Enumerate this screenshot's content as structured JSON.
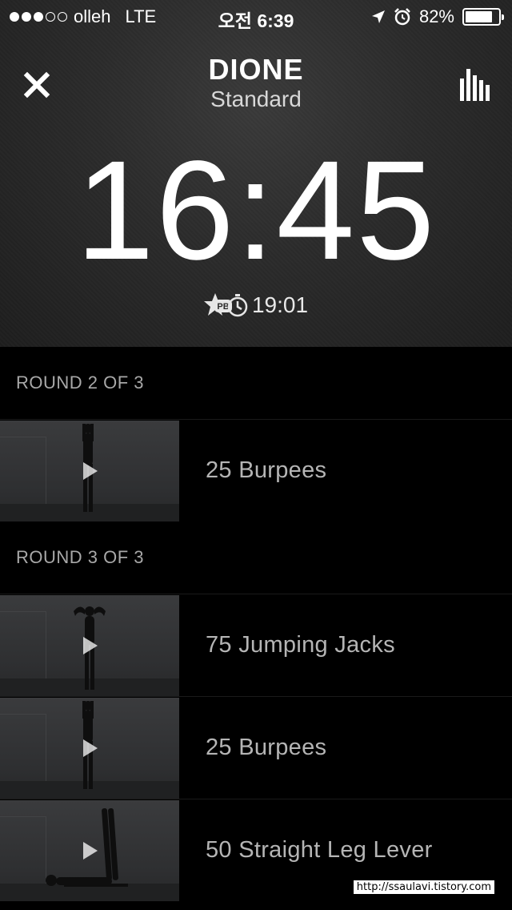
{
  "status_bar": {
    "carrier": "olleh",
    "network": "LTE",
    "time": "오전 6:39",
    "battery_percent": "82%",
    "battery_level": 0.82,
    "signal_bars_filled": 3,
    "signal_bars_total": 5
  },
  "header": {
    "workout_name": "DIONE",
    "variant": "Standard",
    "elapsed_time": "16:45",
    "personal_best": "19:01",
    "pb_badge": "PB"
  },
  "rounds": [
    {
      "label": "ROUND 2 OF 3",
      "exercises": [
        {
          "label": "25 Burpees",
          "pose": "standing-arms-up"
        }
      ]
    },
    {
      "label": "ROUND 3 OF 3",
      "exercises": [
        {
          "label": "75 Jumping Jacks",
          "pose": "standing-hands-head"
        },
        {
          "label": "25 Burpees",
          "pose": "standing-arms-up"
        },
        {
          "label": "50 Straight Leg Lever",
          "pose": "lying-legs-up"
        }
      ]
    }
  ],
  "watermark": "http://ssaulavi.tistory.com",
  "colors": {
    "background": "#000000",
    "hero": "#2b2b2b",
    "text_primary": "#ffffff",
    "text_secondary": "#b5b5b5"
  }
}
